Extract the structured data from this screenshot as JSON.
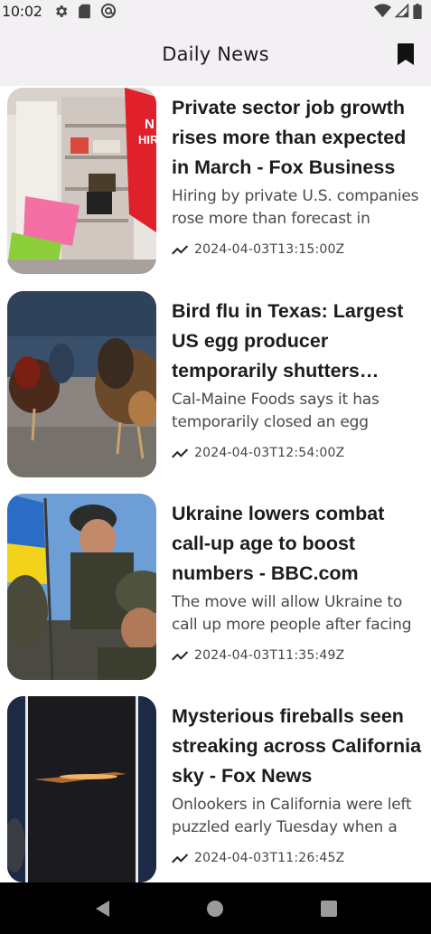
{
  "status_bar": {
    "time": "10:02",
    "left_icons": [
      "gear-icon",
      "sd-card-icon",
      "at-icon"
    ],
    "right_icons": [
      "wifi-icon",
      "signal-icon",
      "battery-icon"
    ]
  },
  "app_bar": {
    "title": "Daily News",
    "action_icon": "bookmark-icon"
  },
  "articles": [
    {
      "headline": "Private sector job growth rises more than expected in March - Fox Business",
      "description": "Hiring by private U.S. companies rose more than forecast in",
      "date": "2024-04-03T13:15:00Z",
      "image": "store-hiring-sign",
      "trend_icon": "trending-icon"
    },
    {
      "headline": "Bird flu in Texas: Largest US egg producer temporarily shutters facility",
      "description": "Cal-Maine Foods says it has temporarily closed an egg",
      "date": "2024-04-03T12:54:00Z",
      "image": "chickens",
      "trend_icon": "trending-icon"
    },
    {
      "headline": "Ukraine lowers combat call-up age to boost numbers - BBC.com",
      "description": "The move will allow Ukraine to call up more people after facing",
      "date": "2024-04-03T11:35:49Z",
      "image": "soldiers-flag",
      "trend_icon": "trending-icon"
    },
    {
      "headline": "Mysterious fireballs seen streaking across California sky - Fox News",
      "description": "Onlookers in California were left puzzled early Tuesday when a",
      "date": "2024-04-03T11:26:45Z",
      "image": "night-fireball",
      "trend_icon": "trending-icon"
    }
  ],
  "nav_bar": {
    "buttons": [
      "back-icon",
      "home-icon",
      "recents-icon"
    ]
  },
  "colors": {
    "app_bar_bg": "#f3f0f4",
    "nav_bar_bg": "#000000",
    "headline": "#1d1b20"
  }
}
